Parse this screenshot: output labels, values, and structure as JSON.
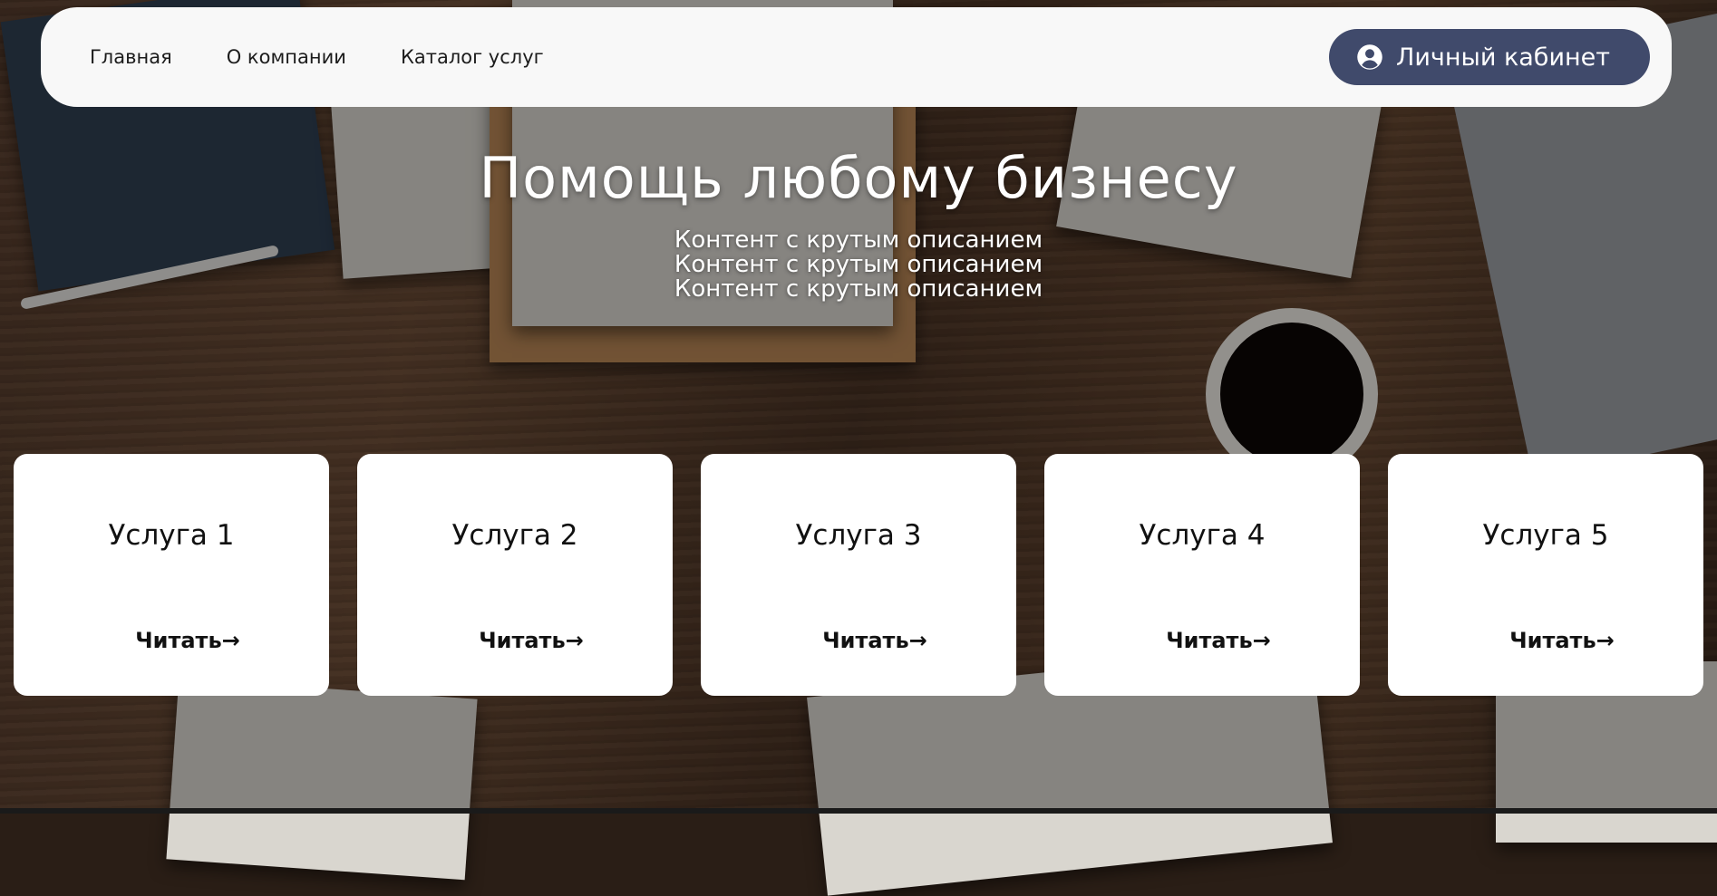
{
  "nav": {
    "items": [
      {
        "label": "Главная"
      },
      {
        "label": "О компании"
      },
      {
        "label": "Каталог услуг"
      }
    ],
    "account_button": {
      "label": "Личный кабинет",
      "icon": "user-circle-icon"
    }
  },
  "hero": {
    "title": "Помощь любому бизнесу",
    "lines": [
      "Контент с крутым описанием",
      "Контент с крутым описанием",
      "Контент с крутым описанием"
    ]
  },
  "services": [
    {
      "title": "Услуга 1",
      "link_label": "Читать",
      "link_icon": "arrow-right-icon"
    },
    {
      "title": "Услуга 2",
      "link_label": "Читать",
      "link_icon": "arrow-right-icon"
    },
    {
      "title": "Услуга 3",
      "link_label": "Читать",
      "link_icon": "arrow-right-icon"
    },
    {
      "title": "Услуга 4",
      "link_label": "Читать",
      "link_icon": "arrow-right-icon"
    },
    {
      "title": "Услуга 5",
      "link_label": "Читать",
      "link_icon": "arrow-right-icon"
    }
  ],
  "colors": {
    "header_bg": "#f8f8f8",
    "account_button_bg": "#404a6b",
    "card_bg": "#ffffff",
    "hero_text": "#ffffff"
  }
}
